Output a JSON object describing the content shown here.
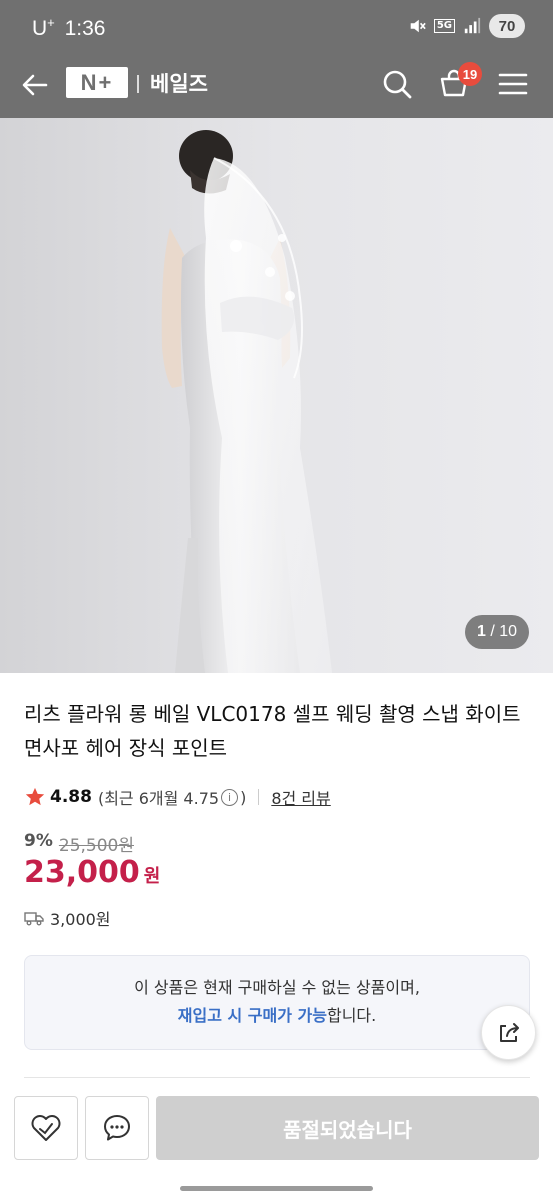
{
  "status_bar": {
    "carrier": "U",
    "carrier_sup": "+",
    "time": "1:36",
    "network": "5G",
    "battery": "70"
  },
  "header": {
    "logo_text": "N+",
    "store_name": "베일즈",
    "cart_count": "19",
    "icons": [
      "back-arrow-icon",
      "search-icon",
      "cart-icon",
      "menu-icon"
    ],
    "bg_color": "#707070"
  },
  "gallery": {
    "current": "1",
    "total": "/ 10"
  },
  "product": {
    "title": "리츠 플라워 롱 베일 VLC0178 셀프 웨딩 촬영 스냅 화이트 면사포 헤어 장식 포인트",
    "rating": "4.88",
    "recent_prefix": "(최근 6개월 4.75",
    "recent_suffix": ")",
    "review_link": "8건 리뷰",
    "discount": "9%",
    "original_price": "25,500원",
    "price": "23,000",
    "currency": "원",
    "shipping": "3,000원",
    "price_color": "#c4204a"
  },
  "notice": {
    "line1": "이 상품은 현재 구매하실 수 없는 상품이며,",
    "line2_em": "재입고 시 구매가 가능",
    "line2_rest": "합니다."
  },
  "bottom_bar": {
    "soldout_label": "품절되었습니다",
    "icons": [
      "heart-icon",
      "chat-icon",
      "share-icon"
    ]
  }
}
